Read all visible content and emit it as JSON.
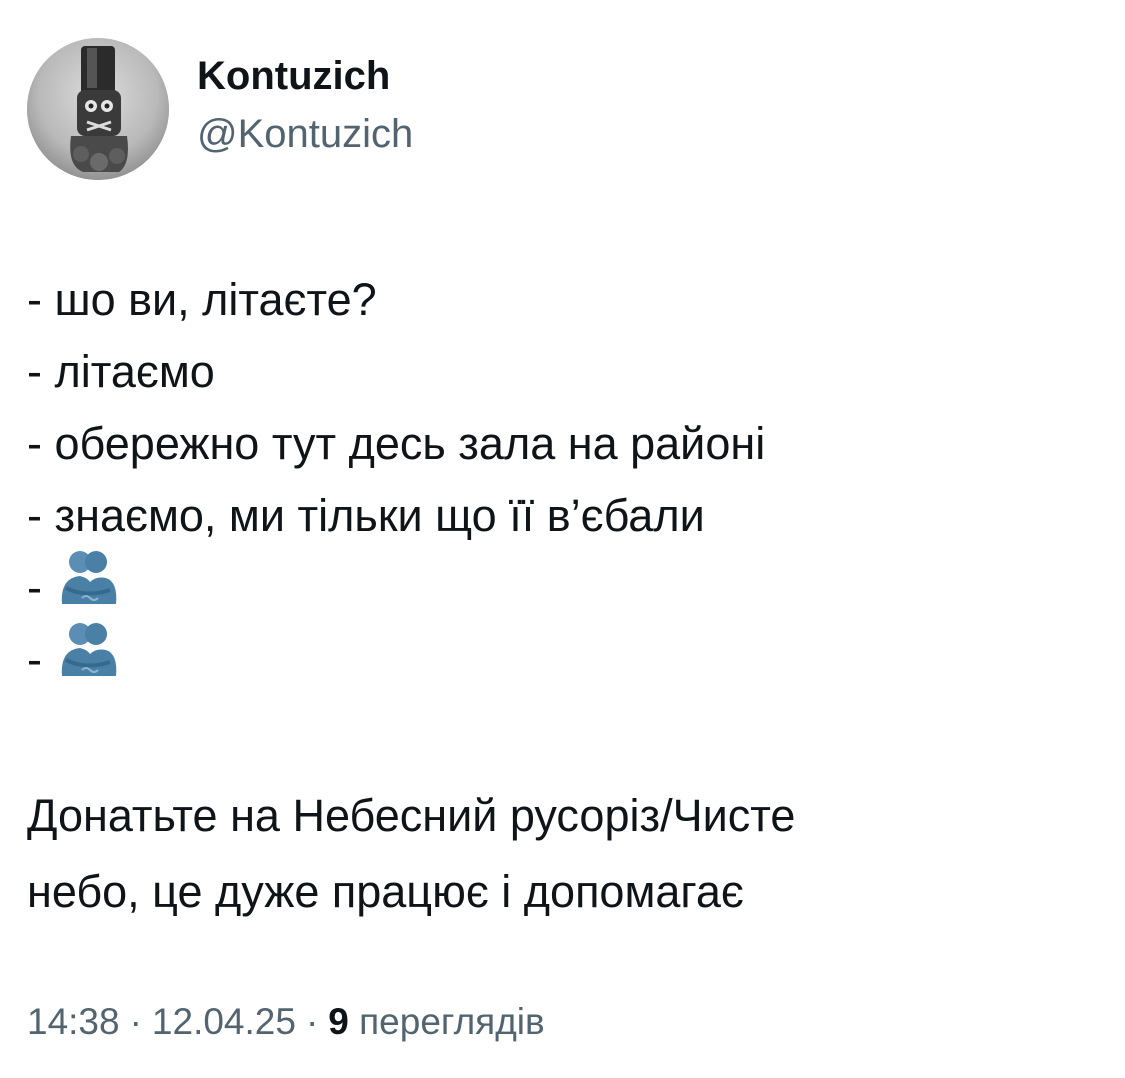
{
  "author": {
    "display_name": "Kontuzich",
    "handle": "@Kontuzich"
  },
  "tweet": {
    "dialog": [
      {
        "text": "- шо ви, літаєте?"
      },
      {
        "text": "- літаємо"
      },
      {
        "text": "- обережно тут десь зала на районі"
      },
      {
        "text": "- знаємо, ми тільки що її в’єбали"
      },
      {
        "text": "-",
        "emoji": "people-hugging-icon"
      },
      {
        "text": "-",
        "emoji": "people-hugging-icon"
      }
    ],
    "paragraph": [
      "Донатьте на Небесний русоріз/Чисте",
      "небо, це дуже працює і допомагає"
    ]
  },
  "meta": {
    "time": "14:38",
    "date": "12.04.25",
    "separator": "·",
    "views_count": "9",
    "views_label": "переглядів"
  },
  "colors": {
    "text": "#0f1419",
    "secondary": "#536471",
    "emoji": "#4a7fa6"
  }
}
